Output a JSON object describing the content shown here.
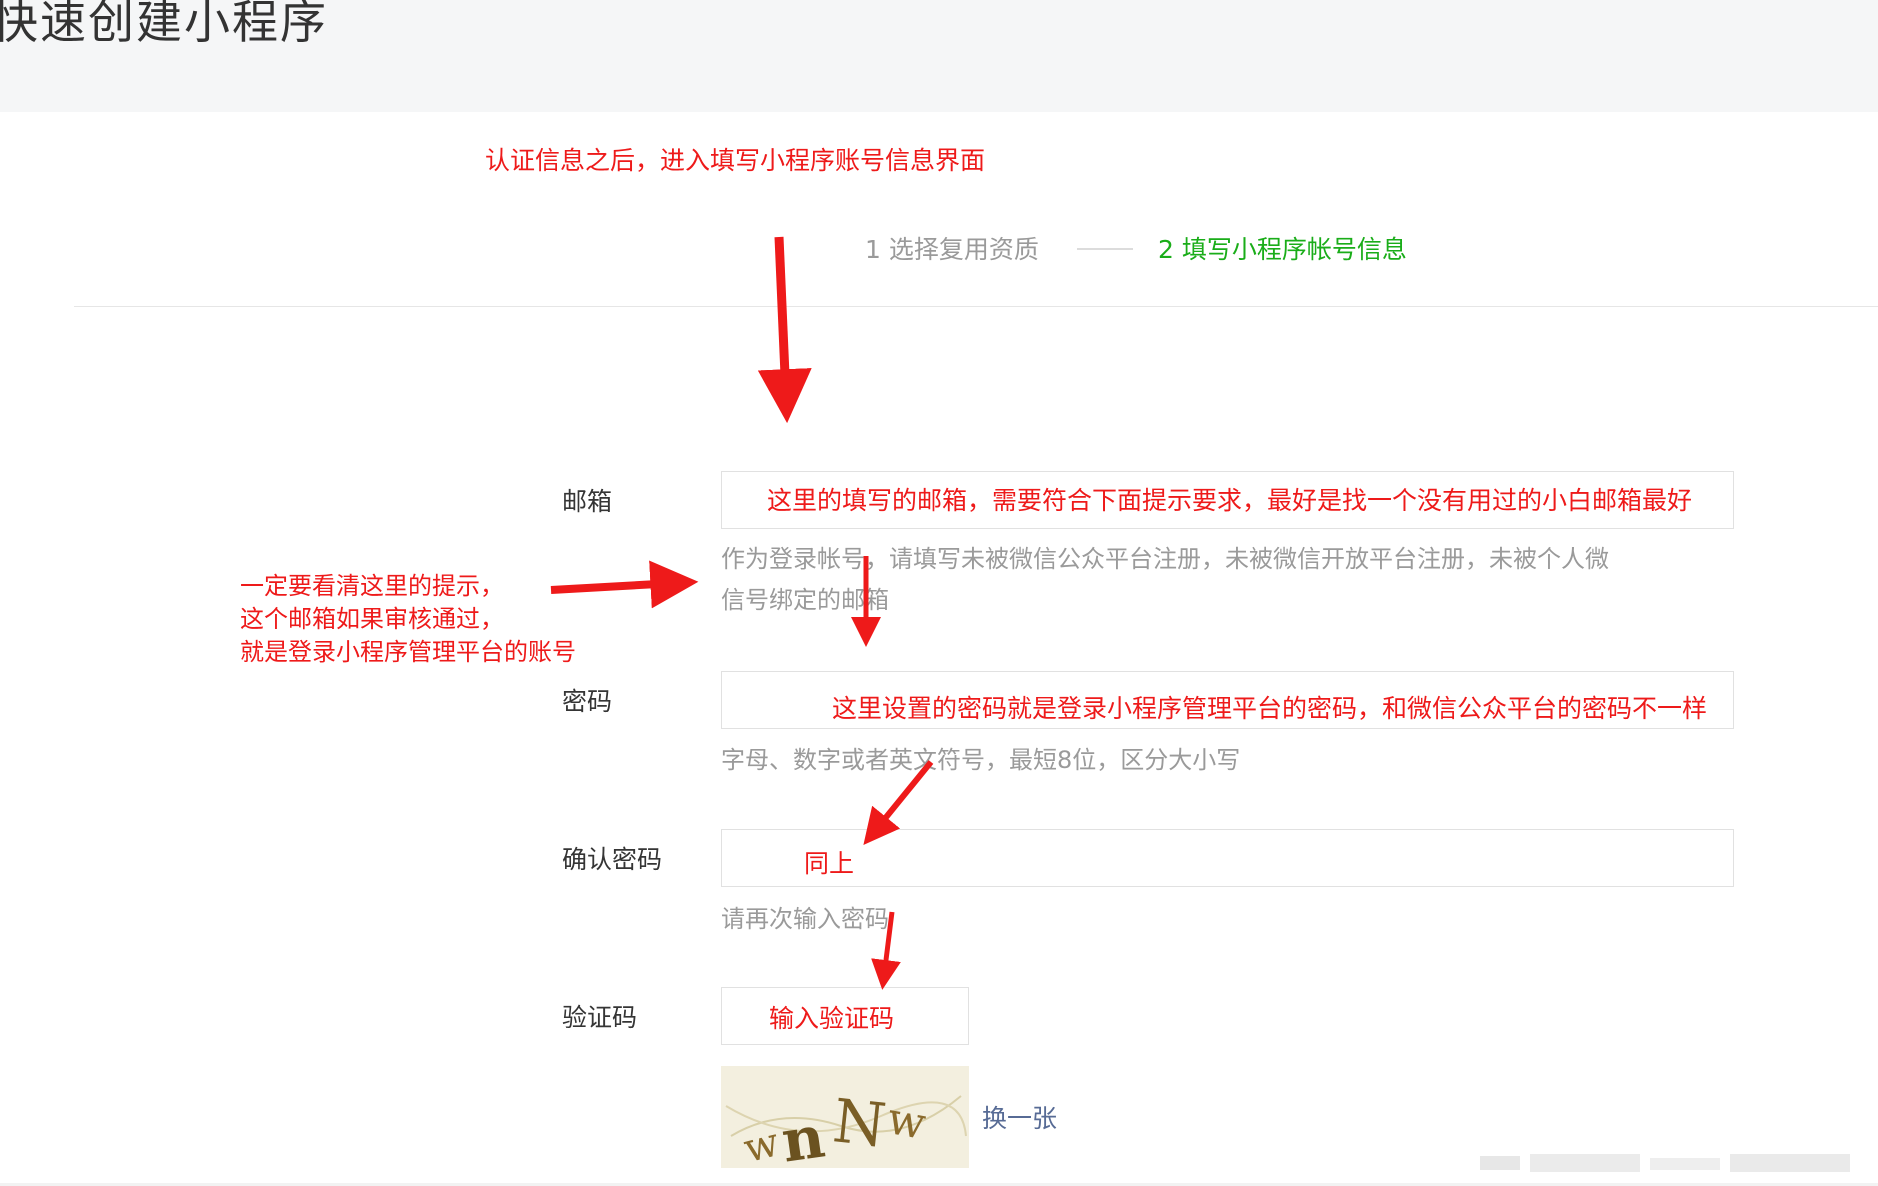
{
  "header": {
    "title": "快速创建小程序"
  },
  "annotations": {
    "top": "认证信息之后，进入填写小程序账号信息界面",
    "email": "这里的填写的邮箱，需要符合下面提示要求，最好是找一个没有用过的小白邮箱最好",
    "left_lines": [
      "一定要看清这里的提示，",
      "这个邮箱如果审核通过，",
      "就是登录小程序管理平台的账号"
    ],
    "password": "这里设置的密码就是登录小程序管理平台的密码，和微信公众平台的密码不一样",
    "confirm": "同上",
    "captcha": "输入验证码"
  },
  "steps": [
    {
      "label": "1 选择复用资质",
      "active": false
    },
    {
      "label": "2 填写小程序帐号信息",
      "active": true
    }
  ],
  "form": {
    "email": {
      "label": "邮箱",
      "hint_lines": [
        "作为登录帐号，请填写未被微信公众平台注册，未被微信开放平台注册，未被个人微",
        "信号绑定的邮箱"
      ]
    },
    "password": {
      "label": "密码",
      "hint": "字母、数字或者英文符号，最短8位，区分大小写"
    },
    "confirm_password": {
      "label": "确认密码",
      "hint": "请再次输入密码"
    },
    "captcha": {
      "label": "验证码",
      "image_text": "wnNw",
      "refresh_label": "换一张"
    }
  },
  "colors": {
    "annotation": "#ee1a1a",
    "active_step": "#1aad19",
    "link": "#576b95",
    "muted": "#9a9a9a"
  },
  "icons": {
    "arrows": "red-arrow-icon",
    "captcha": "captcha-image"
  }
}
